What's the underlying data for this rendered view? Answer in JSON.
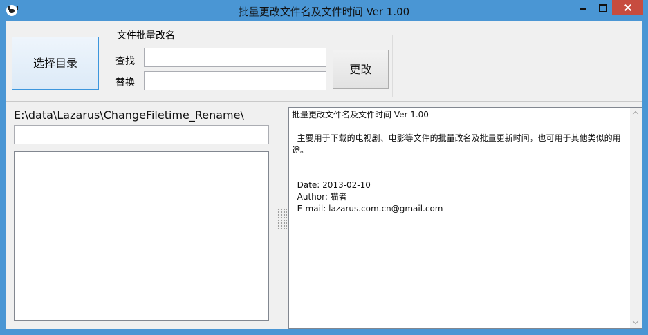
{
  "window": {
    "title": "批量更改文件名及文件时间 Ver 1.00",
    "app_icon": "paw-icon",
    "controls": {
      "minimize": "minimize-icon",
      "maximize": "maximize-icon",
      "close": "close-icon"
    }
  },
  "toolbar": {
    "select_dir_label": "选择目录",
    "group_title": "文件批量改名",
    "find_label": "查找",
    "find_value": "",
    "replace_label": "替换",
    "replace_value": "",
    "change_label": "更改"
  },
  "left_panel": {
    "current_path": "E:\\data\\Lazarus\\ChangeFiletime_Rename\\",
    "path_input_value": "",
    "file_list": []
  },
  "info": {
    "line1": "批量更改文件名及文件时间 Ver 1.00",
    "line2": "  主要用于下载的电视剧、电影等文件的批量改名及批量更新时间，也可用于其他类似的用途。",
    "date": "  Date: 2013-02-10",
    "author": "  Author: 猫者",
    "email": "  E-mail: lazarus.com.cn@gmail.com"
  },
  "colors": {
    "titlebar": "#4a96d4",
    "close_button": "#c74c3f",
    "client_bg": "#f0f0f0",
    "focus_border": "#3c96dd"
  }
}
